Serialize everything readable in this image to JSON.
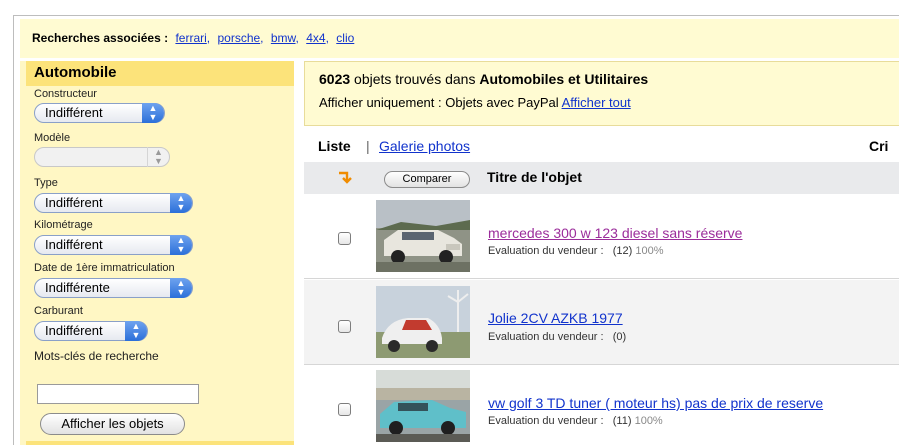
{
  "related": {
    "label": "Recherches associées :",
    "links": [
      "ferrari",
      "porsche",
      "bmw",
      "4x4",
      "clio"
    ]
  },
  "sidebar": {
    "heading": "Automobile",
    "fields": [
      {
        "label": "Constructeur",
        "value": "Indifférent",
        "disabled": false
      },
      {
        "label": "Modèle",
        "value": "",
        "disabled": true
      },
      {
        "label": "Type",
        "value": "Indifférent",
        "disabled": false
      },
      {
        "label": "Kilométrage",
        "value": "Indifférent",
        "disabled": false
      },
      {
        "label": "Date de 1ère immatriculation",
        "value": "Indifférente",
        "disabled": false
      },
      {
        "label": "Carburant",
        "value": "Indifférent",
        "disabled": false
      }
    ],
    "keywords_label": "Mots-clés de recherche",
    "keywords_value": "",
    "show_button": "Afficher les objets"
  },
  "results": {
    "count": "6023",
    "count_text": " objets trouvés dans ",
    "category": "Automobiles et Utilitaires",
    "paypal_text": "Afficher uniquement : Objets avec PayPal ",
    "show_all": "Afficher tout"
  },
  "view": {
    "list": "Liste",
    "separator": "|",
    "gallery": "Galerie photos",
    "cut_column": "Cri"
  },
  "table": {
    "compare_button": "Comparer",
    "title_header": "Titre de l'objet",
    "rows": [
      {
        "title": "mercedes 300 w 123 diesel sans réserve",
        "rating_label": "Evaluation du vendeur :",
        "rating_count": "(12)",
        "rating_pct": "100%",
        "visited": true
      },
      {
        "title": "Jolie 2CV AZKB 1977",
        "rating_label": "Evaluation du vendeur :",
        "rating_count": "(0)",
        "rating_pct": "",
        "visited": false
      },
      {
        "title": "vw golf 3 TD tuner ( moteur hs) pas de prix de reserve",
        "rating_label": "Evaluation du vendeur :",
        "rating_count": "(11)",
        "rating_pct": "100%",
        "visited": false
      }
    ]
  },
  "colors": {
    "link": "#1133cc",
    "visited": "#9b2d9b",
    "yellow": "#fffbd2",
    "accent": "#fce37a"
  }
}
